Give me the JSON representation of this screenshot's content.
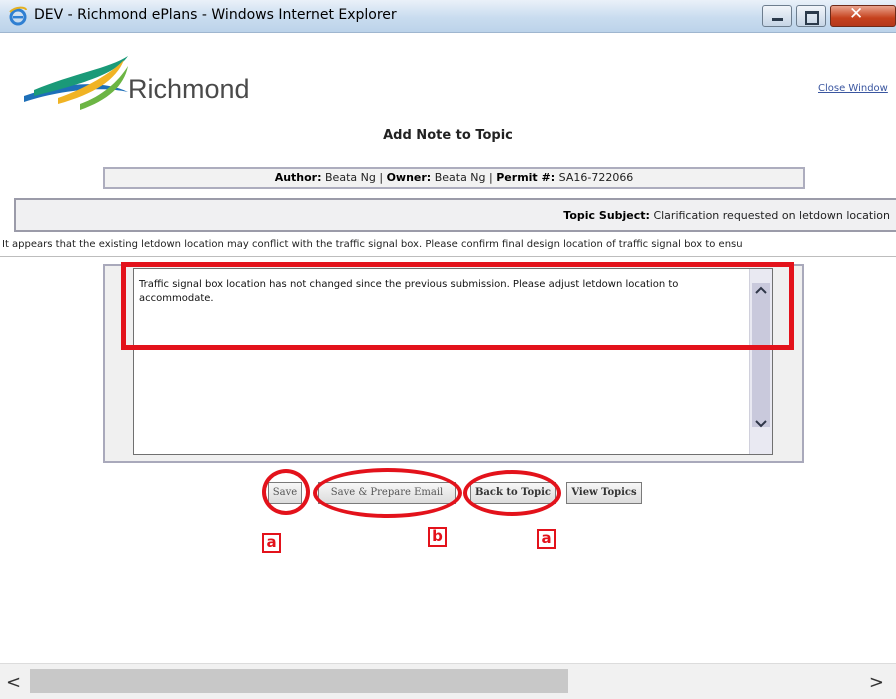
{
  "window": {
    "title": "DEV - Richmond ePlans - Windows Internet Explorer",
    "controls": {
      "close_glyph": "✕"
    }
  },
  "logo": {
    "text": "Richmond"
  },
  "header": {
    "close_window": "Close Window"
  },
  "page": {
    "title": "Add Note to Topic"
  },
  "author_bar": {
    "author_label": "Author:",
    "author_value": "Beata Ng",
    "sep1": "|",
    "owner_label": "Owner:",
    "owner_value": "Beata Ng",
    "sep2": "|",
    "permit_label": "Permit #:",
    "permit_value": "SA16-722066"
  },
  "subject": {
    "label": "Topic Subject:",
    "value": "Clarification requested on letdown location"
  },
  "description": "It appears that the existing letdown location may conflict with the traffic signal box. Please confirm final design location of traffic signal box to ensu",
  "note": {
    "text": "Traffic signal  box location has not changed since the previous submission. Please adjust letdown location to accommodate."
  },
  "buttons": {
    "save": "Save",
    "save_prepare": "Save & Prepare Email",
    "back": "Back to Topic",
    "view": "View Topics"
  },
  "annotations": {
    "label_a": "a",
    "label_b": "b",
    "color": "#e3121b"
  },
  "scrollbar": {
    "left_arrow": "<",
    "right_arrow": ">"
  },
  "colors": {
    "accent_red": "#e3121b",
    "link_blue": "#3a56a0"
  }
}
